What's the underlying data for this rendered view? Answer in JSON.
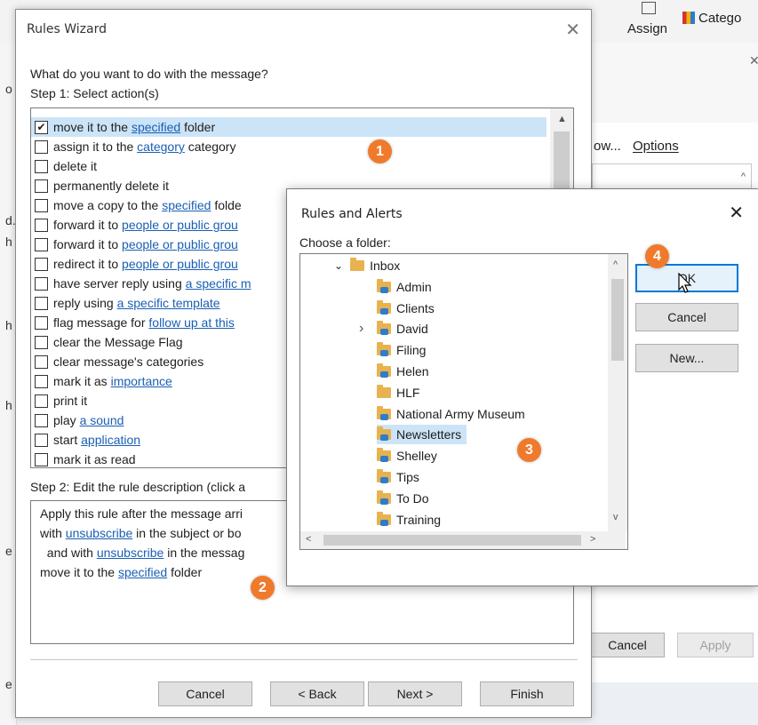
{
  "background": {
    "ribbon_assign": "Assign",
    "ribbon_categorize": "Catego",
    "panel_link": "ow...",
    "panel_options": "Options",
    "cancel": "Cancel",
    "apply": "Apply",
    "left_letters": [
      "o",
      "d.",
      "h",
      "h",
      "h",
      "e",
      "e"
    ]
  },
  "wizard": {
    "title": "Rules Wizard",
    "question": "What do you want to do with the message?",
    "step1": "Step 1: Select action(s)",
    "actions": [
      {
        "pre": "move it to the ",
        "link": "specified",
        "post": " folder",
        "checked": true
      },
      {
        "pre": "assign it to the ",
        "link": "category",
        "post": " category",
        "checked": false
      },
      {
        "pre": "delete it",
        "link": "",
        "post": "",
        "checked": false
      },
      {
        "pre": "permanently delete it",
        "link": "",
        "post": "",
        "checked": false
      },
      {
        "pre": "move a copy to the ",
        "link": "specified",
        "post": " folde",
        "checked": false
      },
      {
        "pre": "forward it to ",
        "link": "people or public grou",
        "post": "",
        "checked": false
      },
      {
        "pre": "forward it to ",
        "link": "people or public grou",
        "post": "",
        "checked": false
      },
      {
        "pre": "redirect it to ",
        "link": "people or public grou",
        "post": "",
        "checked": false
      },
      {
        "pre": "have server reply using ",
        "link": "a specific m",
        "post": "",
        "checked": false
      },
      {
        "pre": "reply using ",
        "link": "a specific template",
        "post": "",
        "checked": false
      },
      {
        "pre": "flag message for ",
        "link": "follow up at this",
        "post": "",
        "checked": false
      },
      {
        "pre": "clear the Message Flag",
        "link": "",
        "post": "",
        "checked": false
      },
      {
        "pre": "clear message's categories",
        "link": "",
        "post": "",
        "checked": false
      },
      {
        "pre": "mark it as ",
        "link": "importance",
        "post": "",
        "checked": false
      },
      {
        "pre": "print it",
        "link": "",
        "post": "",
        "checked": false
      },
      {
        "pre": "play ",
        "link": "a sound",
        "post": "",
        "checked": false
      },
      {
        "pre": "start ",
        "link": "application",
        "post": "",
        "checked": false
      },
      {
        "pre": "mark it as read",
        "link": "",
        "post": "",
        "checked": false
      }
    ],
    "step2": "Step 2: Edit the rule description (click a",
    "description": [
      {
        "pre": "Apply this rule after the message arri",
        "link": "",
        "post": ""
      },
      {
        "pre": "with ",
        "link": "unsubscribe",
        "post": " in the subject or bo"
      },
      {
        "pre": "  and with ",
        "link": "unsubscribe",
        "post": " in the messag"
      },
      {
        "pre": "move it to the ",
        "link": "specified",
        "post": " folder"
      }
    ],
    "buttons": {
      "cancel": "Cancel",
      "back": "< Back",
      "next": "Next >",
      "finish": "Finish"
    }
  },
  "alerts": {
    "title": "Rules and Alerts",
    "choose": "Choose a folder:",
    "folders": [
      "Inbox",
      "Admin",
      "Clients",
      "David",
      "Filing",
      "Helen",
      "HLF",
      "National Army Museum",
      "Newsletters",
      "Shelley",
      "Tips",
      "To Do",
      "Training"
    ],
    "selected_folder": "Newsletters",
    "buttons": {
      "ok": "OK",
      "cancel": "Cancel",
      "new": "New..."
    }
  },
  "callouts": [
    "1",
    "2",
    "3",
    "4"
  ],
  "colors": {
    "callout": "#f07a2c",
    "link": "#1a5fb4",
    "selection": "#cce4f7",
    "default_button": "#0078d7"
  }
}
